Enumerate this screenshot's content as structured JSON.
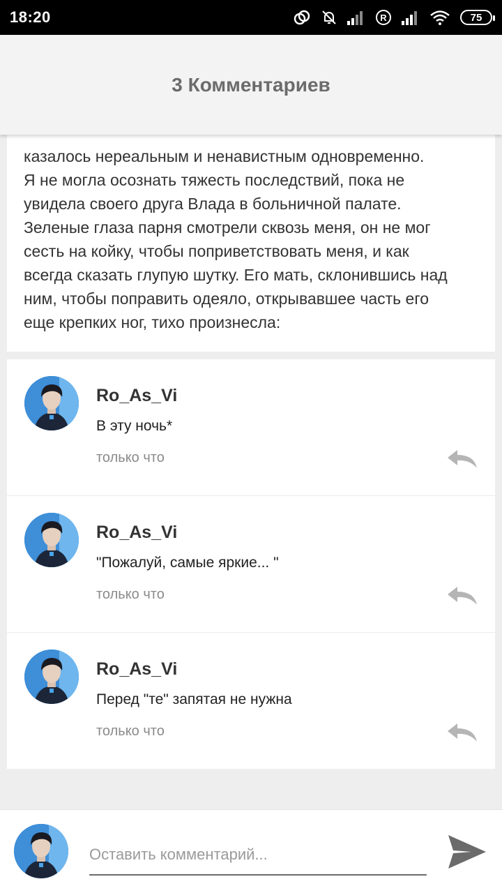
{
  "status_bar": {
    "time": "18:20",
    "battery_level": "75",
    "icons": [
      "sync-icon",
      "bell-muted-icon",
      "signal-icon",
      "registered-icon",
      "signal-icon",
      "wifi-icon",
      "battery-icon"
    ]
  },
  "header": {
    "title": "3 Комментариев"
  },
  "quote": {
    "lines": [
      "казалось нереальным и ненавистным одновременно.",
      "Я не могла осознать тяжесть последствий, пока не",
      "увидела своего друга Влада в больничной палате.",
      "Зеленые глаза парня смотрели сквозь меня, он не мог",
      "сесть на койку, чтобы поприветствовать меня, и как",
      "всегда сказать глупую шутку. Его мать, склонившись над",
      "ним, чтобы поправить одеяло, открывавшее часть его",
      "еще крепких ног, тихо произнесла:"
    ]
  },
  "comments": [
    {
      "author": "Ro_As_Vi",
      "text": "В эту ночь*",
      "time": "только что"
    },
    {
      "author": "Ro_As_Vi",
      "text": "\"Пожалуй, самые яркие... \"",
      "time": "только что"
    },
    {
      "author": "Ro_As_Vi",
      "text": "Перед \"те\" запятая не нужна",
      "time": "только что"
    }
  ],
  "input": {
    "placeholder": "Оставить комментарий...",
    "value": ""
  },
  "colors": {
    "background": "#efeeef",
    "header_bg": "#f3f3f3",
    "title_color": "#6b6b6b",
    "secondary_text": "#8a8a8a",
    "icon_gray": "#b5b5b5"
  }
}
